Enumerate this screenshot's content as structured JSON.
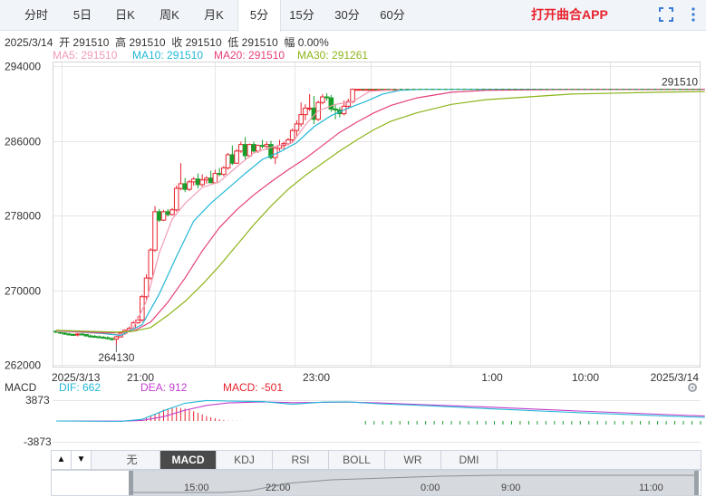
{
  "tabs": [
    {
      "label": "分时",
      "active": false
    },
    {
      "label": "5日",
      "active": false
    },
    {
      "label": "日K",
      "active": false
    },
    {
      "label": "周K",
      "active": false
    },
    {
      "label": "月K",
      "active": false
    },
    {
      "label": "5分",
      "active": true
    },
    {
      "label": "15分",
      "active": false
    },
    {
      "label": "30分",
      "active": false
    },
    {
      "label": "60分",
      "active": false
    }
  ],
  "app_link": "打开曲合APP",
  "icons": {
    "fullscreen": "fullscreen-icon",
    "more": "more-icon"
  },
  "info": {
    "date": "2025/3/14",
    "open_label": "开",
    "open": "291510",
    "high_label": "高",
    "high": "291510",
    "close_label": "收",
    "close": "291510",
    "low_label": "低",
    "low": "291510",
    "change_label": "幅",
    "change": "0.00%"
  },
  "ma": [
    {
      "label": "MA5: 291510",
      "color": "#f09bb3"
    },
    {
      "label": "MA10: 291510",
      "color": "#22b8d6"
    },
    {
      "label": "MA20: 291510",
      "color": "#e5407a"
    },
    {
      "label": "MA30: 291261",
      "color": "#8cb41a"
    }
  ],
  "colors": {
    "up": "#e8222d",
    "down": "#1a9e2b",
    "grid": "#e6e6e6"
  },
  "chart_data": {
    "type": "candlestick",
    "y_ticks": [
      "294000",
      "286000",
      "278000",
      "270000",
      "262000"
    ],
    "ylim": [
      262000,
      294000
    ],
    "x_ticks": [
      "2025/3/13",
      "21:00",
      "23:00",
      "1:00",
      "10:00",
      "2025/3/14"
    ],
    "last_price_label": "291510",
    "low_marker_label": "264130",
    "candles": [
      [
        265600,
        265700,
        265400,
        265500
      ],
      [
        265500,
        265600,
        265300,
        265400
      ],
      [
        265400,
        265550,
        265200,
        265300
      ],
      [
        265300,
        265450,
        265150,
        265250
      ],
      [
        265250,
        265350,
        265100,
        265200
      ],
      [
        265200,
        265400,
        265050,
        265300
      ],
      [
        265300,
        265450,
        265150,
        265250
      ],
      [
        265250,
        265300,
        265000,
        265100
      ],
      [
        265100,
        265250,
        264900,
        265050
      ],
      [
        265050,
        265200,
        264900,
        265000
      ],
      [
        265000,
        265150,
        264850,
        264950
      ],
      [
        264950,
        265100,
        264800,
        264900
      ],
      [
        264900,
        265050,
        264700,
        264800
      ],
      [
        264800,
        264950,
        264600,
        264750
      ],
      [
        264750,
        265100,
        264130,
        265000
      ],
      [
        265000,
        265500,
        264900,
        265400
      ],
      [
        265400,
        265800,
        265200,
        265700
      ],
      [
        265700,
        266100,
        265500,
        265900
      ],
      [
        265900,
        266700,
        265700,
        266500
      ],
      [
        266500,
        267200,
        266400,
        266800
      ],
      [
        266800,
        269500,
        266600,
        269300
      ],
      [
        269300,
        271700,
        269000,
        271300
      ],
      [
        271300,
        274500,
        271100,
        274300
      ],
      [
        274300,
        279000,
        274100,
        278400
      ],
      [
        278400,
        278700,
        277300,
        277500
      ],
      [
        277500,
        278600,
        277400,
        278400
      ],
      [
        278400,
        278700,
        277900,
        278100
      ],
      [
        278100,
        278800,
        278000,
        278600
      ],
      [
        278600,
        281200,
        278400,
        280900
      ],
      [
        280900,
        283600,
        280700,
        281400
      ],
      [
        281400,
        282000,
        280500,
        280800
      ],
      [
        280800,
        281800,
        280600,
        281600
      ],
      [
        281600,
        282100,
        281200,
        281900
      ],
      [
        281900,
        282500,
        280900,
        281300
      ],
      [
        281300,
        282400,
        281100,
        281800
      ],
      [
        281800,
        282200,
        281400,
        282000
      ],
      [
        282000,
        282800,
        281700,
        281500
      ],
      [
        281500,
        282900,
        281400,
        282500
      ],
      [
        282500,
        283100,
        282200,
        282400
      ],
      [
        282400,
        283300,
        282200,
        283100
      ],
      [
        283100,
        284700,
        282900,
        284500
      ],
      [
        284500,
        285500,
        283400,
        283600
      ],
      [
        283600,
        285100,
        283500,
        284900
      ],
      [
        284900,
        285900,
        284700,
        285600
      ],
      [
        285600,
        286400,
        283900,
        284400
      ],
      [
        284400,
        285700,
        284200,
        285600
      ],
      [
        285600,
        285900,
        284700,
        284900
      ],
      [
        284900,
        285600,
        284700,
        285500
      ],
      [
        285500,
        286100,
        285200,
        285400
      ],
      [
        285400,
        285900,
        285000,
        285600
      ],
      [
        285600,
        286000,
        284000,
        284200
      ],
      [
        284200,
        285400,
        283500,
        285200
      ],
      [
        285200,
        286100,
        284900,
        285500
      ],
      [
        285500,
        285900,
        285000,
        285700
      ],
      [
        285700,
        286300,
        285500,
        286100
      ],
      [
        286100,
        287300,
        285900,
        287100
      ],
      [
        287100,
        288200,
        286500,
        287800
      ],
      [
        287800,
        290100,
        287500,
        288800
      ],
      [
        288800,
        289900,
        288200,
        289500
      ],
      [
        289500,
        291000,
        289200,
        289500
      ],
      [
        289500,
        290800,
        287800,
        288300
      ],
      [
        288300,
        290300,
        288100,
        290100
      ],
      [
        290100,
        291000,
        289900,
        290700
      ],
      [
        290700,
        291100,
        290300,
        290600
      ],
      [
        290600,
        290900,
        289100,
        289400
      ],
      [
        289400,
        289900,
        288300,
        289300
      ],
      [
        289300,
        289600,
        288500,
        288900
      ],
      [
        288900,
        290300,
        288700,
        289700
      ],
      [
        289700,
        290500,
        289400,
        290200
      ],
      [
        290200,
        291600,
        290000,
        291510
      ],
      [
        291510,
        291510,
        291510,
        291510
      ],
      [
        291510,
        291510,
        291510,
        291510
      ],
      [
        291510,
        291510,
        291510,
        291510
      ],
      [
        291510,
        291510,
        291510,
        291510
      ],
      [
        291510,
        291510,
        291510,
        291510
      ],
      [
        291510,
        291510,
        291510,
        291510
      ],
      [
        291510,
        291510,
        291510,
        291510
      ],
      [
        291510,
        291510,
        291510,
        291510
      ],
      [
        291510,
        291510,
        291510,
        291510
      ],
      [
        291510,
        291510,
        291510,
        291510
      ]
    ],
    "ma_lines": [
      {
        "name": "MA5",
        "color": "#f09bb3",
        "values": [
          [
            0,
            265600
          ],
          [
            15,
            265250
          ],
          [
            18,
            266000
          ],
          [
            21,
            268800
          ],
          [
            24,
            274000
          ],
          [
            27,
            277600
          ],
          [
            30,
            279300
          ],
          [
            34,
            281000
          ],
          [
            38,
            281600
          ],
          [
            42,
            283200
          ],
          [
            46,
            284700
          ],
          [
            50,
            285300
          ],
          [
            55,
            285800
          ],
          [
            58,
            287700
          ],
          [
            61,
            289200
          ],
          [
            65,
            289900
          ],
          [
            69,
            290200
          ],
          [
            73,
            291300
          ],
          [
            80,
            291510
          ],
          [
            100,
            291510
          ],
          [
            151,
            291510
          ]
        ]
      },
      {
        "name": "MA10",
        "color": "#22b8d6",
        "values": [
          [
            0,
            265700
          ],
          [
            10,
            265400
          ],
          [
            15,
            265150
          ],
          [
            20,
            266300
          ],
          [
            24,
            269600
          ],
          [
            28,
            273600
          ],
          [
            32,
            277400
          ],
          [
            36,
            279300
          ],
          [
            40,
            280900
          ],
          [
            44,
            282500
          ],
          [
            48,
            284000
          ],
          [
            52,
            284800
          ],
          [
            56,
            285800
          ],
          [
            60,
            287500
          ],
          [
            64,
            288700
          ],
          [
            68,
            289500
          ],
          [
            72,
            290200
          ],
          [
            76,
            291000
          ],
          [
            80,
            291400
          ],
          [
            85,
            291510
          ],
          [
            151,
            291510
          ]
        ]
      },
      {
        "name": "MA20",
        "color": "#e5407a",
        "values": [
          [
            0,
            265700
          ],
          [
            12,
            265400
          ],
          [
            18,
            265600
          ],
          [
            22,
            266600
          ],
          [
            26,
            268700
          ],
          [
            30,
            271300
          ],
          [
            34,
            274200
          ],
          [
            38,
            276700
          ],
          [
            42,
            278600
          ],
          [
            46,
            280200
          ],
          [
            50,
            281600
          ],
          [
            54,
            282900
          ],
          [
            58,
            284100
          ],
          [
            62,
            285500
          ],
          [
            66,
            286900
          ],
          [
            70,
            288000
          ],
          [
            74,
            289000
          ],
          [
            78,
            289800
          ],
          [
            84,
            290600
          ],
          [
            92,
            291200
          ],
          [
            100,
            291400
          ],
          [
            120,
            291500
          ],
          [
            151,
            291510
          ]
        ]
      },
      {
        "name": "MA30",
        "color": "#8cb41a",
        "values": [
          [
            0,
            265700
          ],
          [
            14,
            265500
          ],
          [
            18,
            265600
          ],
          [
            22,
            266000
          ],
          [
            26,
            267300
          ],
          [
            30,
            268800
          ],
          [
            34,
            270600
          ],
          [
            38,
            272600
          ],
          [
            42,
            274800
          ],
          [
            46,
            277000
          ],
          [
            50,
            279000
          ],
          [
            54,
            280800
          ],
          [
            58,
            282300
          ],
          [
            62,
            283600
          ],
          [
            66,
            284900
          ],
          [
            70,
            286100
          ],
          [
            74,
            287200
          ],
          [
            78,
            288100
          ],
          [
            84,
            289000
          ],
          [
            92,
            289900
          ],
          [
            100,
            290400
          ],
          [
            110,
            290700
          ],
          [
            120,
            291000
          ],
          [
            140,
            291200
          ],
          [
            151,
            291261
          ]
        ]
      }
    ],
    "macd": {
      "label": "MACD",
      "dif_label": "DIF: 662",
      "dif_color": "#22b8d6",
      "dea_label": "DEA: 912",
      "dea_color": "#c33ecf",
      "macd_label": "MACD: -501",
      "macd_color": "#e8222d",
      "y_ticks": [
        "3873",
        "-3873"
      ],
      "ylim": [
        -3873,
        3873
      ],
      "dif": [
        [
          0,
          0
        ],
        [
          15,
          -60
        ],
        [
          20,
          300
        ],
        [
          25,
          1900
        ],
        [
          30,
          3300
        ],
        [
          35,
          3800
        ],
        [
          40,
          3700
        ],
        [
          48,
          3600
        ],
        [
          55,
          3100
        ],
        [
          62,
          3500
        ],
        [
          68,
          3550
        ],
        [
          75,
          3200
        ],
        [
          85,
          2900
        ],
        [
          100,
          2300
        ],
        [
          120,
          1600
        ],
        [
          151,
          662
        ]
      ],
      "dea": [
        [
          0,
          0
        ],
        [
          15,
          -40
        ],
        [
          20,
          100
        ],
        [
          25,
          800
        ],
        [
          30,
          2000
        ],
        [
          35,
          2900
        ],
        [
          40,
          3350
        ],
        [
          48,
          3550
        ],
        [
          55,
          3400
        ],
        [
          62,
          3450
        ],
        [
          68,
          3500
        ],
        [
          75,
          3350
        ],
        [
          85,
          3050
        ],
        [
          100,
          2600
        ],
        [
          120,
          1900
        ],
        [
          151,
          912
        ]
      ],
      "hist": [
        [
          20,
          400
        ],
        [
          21,
          700
        ],
        [
          22,
          1000
        ],
        [
          23,
          1300
        ],
        [
          24,
          1700
        ],
        [
          25,
          2100
        ],
        [
          26,
          2300
        ],
        [
          27,
          2400
        ],
        [
          28,
          2500
        ],
        [
          29,
          2400
        ],
        [
          30,
          2300
        ],
        [
          31,
          2100
        ],
        [
          32,
          1800
        ],
        [
          33,
          1500
        ],
        [
          34,
          1200
        ],
        [
          35,
          900
        ],
        [
          36,
          700
        ],
        [
          37,
          500
        ],
        [
          38,
          300
        ],
        [
          39,
          150
        ],
        [
          40,
          60
        ],
        [
          41,
          40
        ],
        [
          42,
          30
        ],
        [
          43,
          20
        ]
      ]
    },
    "navigator": {
      "labels": [
        "15:00",
        "22:00",
        "0:00",
        "9:00",
        "11:00"
      ]
    }
  },
  "bottom": {
    "indicators": [
      "无",
      "MACD",
      "KDJ",
      "RSI",
      "BOLL",
      "WR",
      "DMI"
    ],
    "active_indicator": "MACD"
  }
}
